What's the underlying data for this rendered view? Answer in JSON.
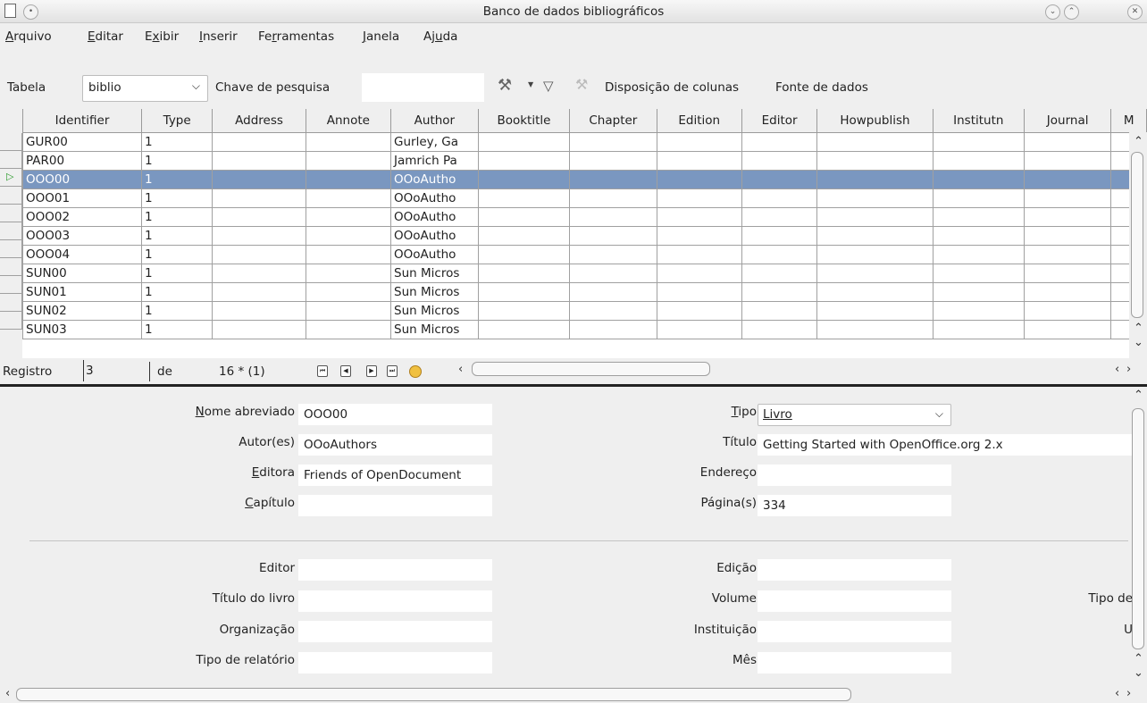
{
  "window": {
    "title": "Banco de dados bibliográficos"
  },
  "menu": [
    {
      "label": "Arquivo",
      "u": 0
    },
    {
      "label": "Editar",
      "u": 0
    },
    {
      "label": "Exibir",
      "u": 1
    },
    {
      "label": "Inserir",
      "u": 0
    },
    {
      "label": "Ferramentas",
      "u": 2
    },
    {
      "label": "Janela",
      "u": 0
    },
    {
      "label": "Ajuda",
      "u": 2
    }
  ],
  "toolbar": {
    "table_label": "Tabela",
    "table_value": "biblio",
    "search_key_label": "Chave de pesquisa",
    "search_value": "",
    "column_layout": "Disposição de colunas",
    "data_source": "Fonte de dados"
  },
  "grid": {
    "columns": [
      "Identifier",
      "Type",
      "Address",
      "Annote",
      "Author",
      "Booktitle",
      "Chapter",
      "Edition",
      "Editor",
      "Howpublish",
      "Institutn",
      "Journal",
      "M"
    ],
    "rows": [
      [
        "GUR00",
        "1",
        "",
        "",
        "Gurley, Ga"
      ],
      [
        "PAR00",
        "1",
        "",
        "",
        "Jamrich Pa"
      ],
      [
        "OOO00",
        "1",
        "",
        "",
        "OOoAutho"
      ],
      [
        "OOO01",
        "1",
        "",
        "",
        "OOoAutho"
      ],
      [
        "OOO02",
        "1",
        "",
        "",
        "OOoAutho"
      ],
      [
        "OOO03",
        "1",
        "",
        "",
        "OOoAutho"
      ],
      [
        "OOO04",
        "1",
        "",
        "",
        "OOoAutho"
      ],
      [
        "SUN00",
        "1",
        "",
        "",
        "Sun Micros"
      ],
      [
        "SUN01",
        "1",
        "",
        "",
        "Sun Micros"
      ],
      [
        "SUN02",
        "1",
        "",
        "",
        "Sun Micros"
      ],
      [
        "SUN03",
        "1",
        "",
        "",
        "Sun Micros"
      ]
    ],
    "selected_row": 2
  },
  "navigation": {
    "record_label": "Registro",
    "record_value": "3",
    "of_label": "de",
    "total": "16 * (1)"
  },
  "form": {
    "short_name_label": "Nome abreviado",
    "short_name": "OOO00",
    "type_label": "Tipo",
    "type_value": "Livro",
    "authors_label": "Autor(es)",
    "authors": "OOoAuthors",
    "title_label": "Título",
    "title": "Getting Started with OpenOffice.org 2.x",
    "publisher_label": "Editora",
    "publisher": "Friends of OpenDocument",
    "address_label": "Endereço",
    "address": "",
    "chapter_label": "Capítulo",
    "chapter": "",
    "pages_label": "Página(s)",
    "pages": "334",
    "editor_label": "Editor",
    "editor": "",
    "edition_label": "Edição",
    "edition": "",
    "booktitle_label": "Título do livro",
    "booktitle": "",
    "volume_label": "Volume",
    "volume": "",
    "pubtype_label": "Tipo de",
    "organization_label": "Organização",
    "organization": "",
    "institution_label": "Instituição",
    "institution": "",
    "u_label": "U",
    "report_type_label": "Tipo de relatório",
    "report_type": "",
    "month_label": "Mês",
    "month": ""
  }
}
